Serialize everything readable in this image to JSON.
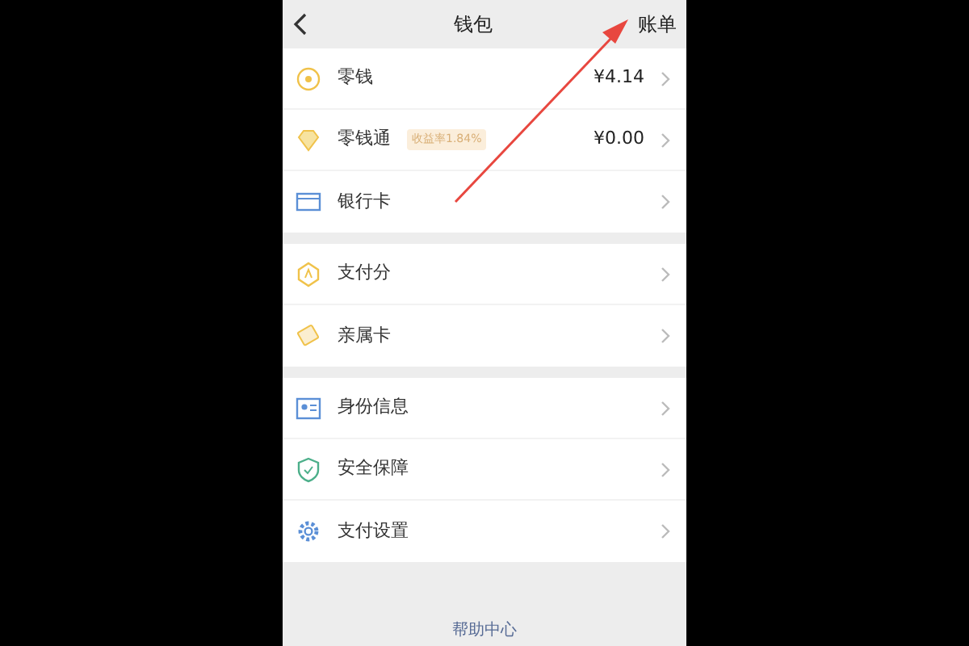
{
  "header": {
    "title": "钱包",
    "action": "账单"
  },
  "groups": [
    [
      {
        "kind": "coin",
        "label": "零钱",
        "value": "¥4.14"
      },
      {
        "kind": "diamond",
        "label": "零钱通",
        "badge": "收益率1.84%",
        "value": "¥0.00"
      },
      {
        "kind": "card",
        "label": "银行卡"
      }
    ],
    [
      {
        "kind": "score",
        "label": "支付分"
      },
      {
        "kind": "family",
        "label": "亲属卡"
      }
    ],
    [
      {
        "kind": "id",
        "label": "身份信息"
      },
      {
        "kind": "shield",
        "label": "安全保障"
      },
      {
        "kind": "gear",
        "label": "支付设置"
      }
    ]
  ],
  "footer": "帮助中心"
}
